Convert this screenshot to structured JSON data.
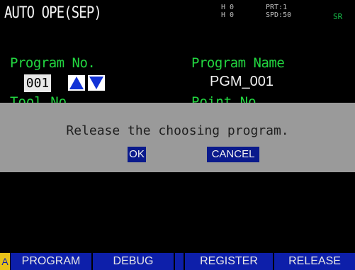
{
  "screen": {
    "title": "AUTO OPE(SEP)",
    "status_left": "H 0\nH 0",
    "status_right": "PRT:1\nSPD:50",
    "status_extra": "SR"
  },
  "program": {
    "number_label": "Program No.",
    "number_value": "001",
    "name_label": "Program Name",
    "name_value": "PGM_001",
    "row2_left_label": "Tool No.",
    "row2_right_label": "Point No."
  },
  "dialog": {
    "message": "Release the choosing program.",
    "ok_label": "OK",
    "cancel_label": "CANCEL"
  },
  "function_keys": {
    "shift_label": "A",
    "keys": [
      "PROGRAM",
      "DEBUG",
      "",
      "REGISTER",
      "RELEASE"
    ]
  },
  "colors": {
    "background": "#000000",
    "label_green": "#22d640",
    "dialog_gray": "#9a9a9a",
    "button_blue": "#0a1a8c",
    "fkey_blue": "#0d1faa",
    "shift_yellow": "#e8c21a"
  },
  "icons": {
    "increment": "triangle-up-icon",
    "decrement": "triangle-down-icon"
  }
}
